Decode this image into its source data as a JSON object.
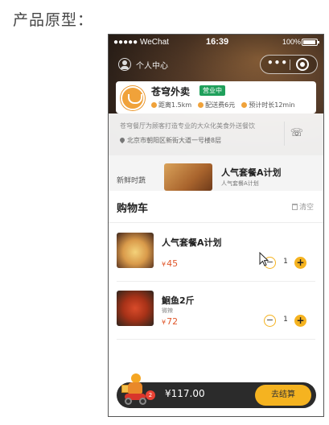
{
  "caption": "产品原型：",
  "status_bar": {
    "carrier": "●●●●● WeChat",
    "time": "16:39",
    "battery": "100%"
  },
  "header": {
    "personal_center": "个人中心",
    "capsule_dots": "•••"
  },
  "store": {
    "name": "苍穹外卖",
    "status": "营业中",
    "distance": "距离1.5km",
    "delivery_fee": "配送费6元",
    "eta": "预计时长12min",
    "description": "苍穹餐厅为顾客打造专业的大众化美食外送餐饮",
    "address": "北京市朝阳区新街大道一号楼8层"
  },
  "menu": {
    "category": "新鲜时蔬",
    "item_title": "人气套餐A计划",
    "item_sub": "人气套餐A计划"
  },
  "cart": {
    "title": "购物车",
    "clear_label": "清空",
    "items": [
      {
        "name": "人气套餐A计划",
        "spec": "",
        "currency": "¥",
        "price": "45",
        "quantity": "1"
      },
      {
        "name": "鮰鱼2斤",
        "spec": "微辣",
        "currency": "¥",
        "price": "72",
        "quantity": "1"
      }
    ],
    "badge_count": "2",
    "total": "¥117.00",
    "checkout_label": "去结算"
  },
  "colors": {
    "accent": "#f5b320",
    "price": "#e0582c",
    "open_badge": "#1fa05b",
    "bar": "#2b2b2b"
  }
}
